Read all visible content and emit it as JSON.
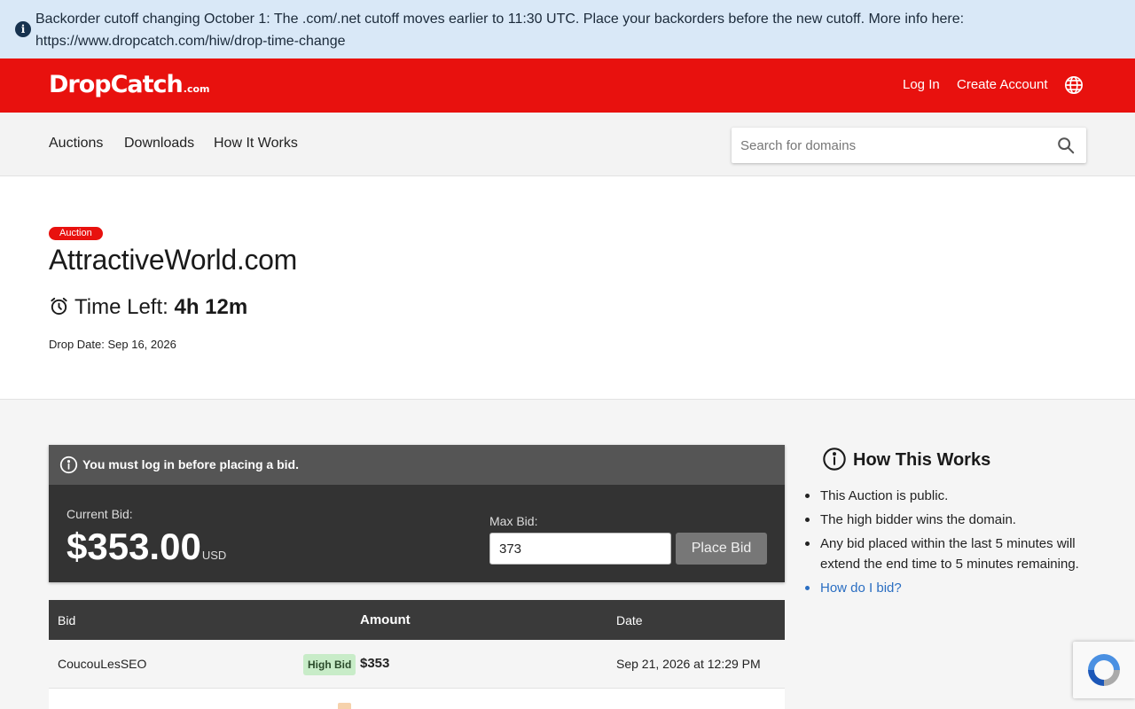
{
  "banner": {
    "message": "Backorder cutoff changing October 1: The .com/.net cutoff moves earlier to 11:30 UTC. Place your backorders before the new cutoff. More info here: https://www.dropcatch.com/hiw/drop-time-change",
    "icon": "info-icon"
  },
  "header": {
    "logo_main": "DropCatch",
    "logo_suffix": ".com",
    "login": "Log In",
    "create_account": "Create Account",
    "language_icon": "globe-icon",
    "brand_color": "#e8110e"
  },
  "nav": {
    "items": [
      {
        "label": "Auctions"
      },
      {
        "label": "Downloads"
      },
      {
        "label": "How It Works"
      }
    ],
    "search_placeholder": "Search for domains",
    "search_value": ""
  },
  "domain": {
    "badge": "Auction",
    "name": "AttractiveWorld.com",
    "time_left_label": "Time Left:",
    "time_left_value": "4h 12m",
    "drop_date": "Drop Date: Sep 16, 2026"
  },
  "bid_panel": {
    "notice": "You must log in before placing a bid.",
    "current_bid_label": "Current Bid:",
    "current_bid_amount": "$353.00",
    "current_bid_currency": "USD",
    "max_bid_label": "Max Bid:",
    "max_bid_value": "373",
    "place_bid_label": "Place Bid"
  },
  "bid_table": {
    "headers": {
      "bid": "Bid",
      "amount": "Amount",
      "date": "Date"
    },
    "rows": [
      {
        "bidder": "CoucouLesSEO",
        "badge": "High Bid",
        "amount": "$353",
        "date": "Sep 21, 2026 at 12:29 PM"
      }
    ]
  },
  "how_it_works": {
    "title": "How This Works",
    "items": [
      "This Auction is public.",
      "The high bidder wins the domain.",
      "Any bid placed within the last 5 minutes will extend the end time to 5 minutes remaining."
    ],
    "link": "How do I bid?"
  }
}
